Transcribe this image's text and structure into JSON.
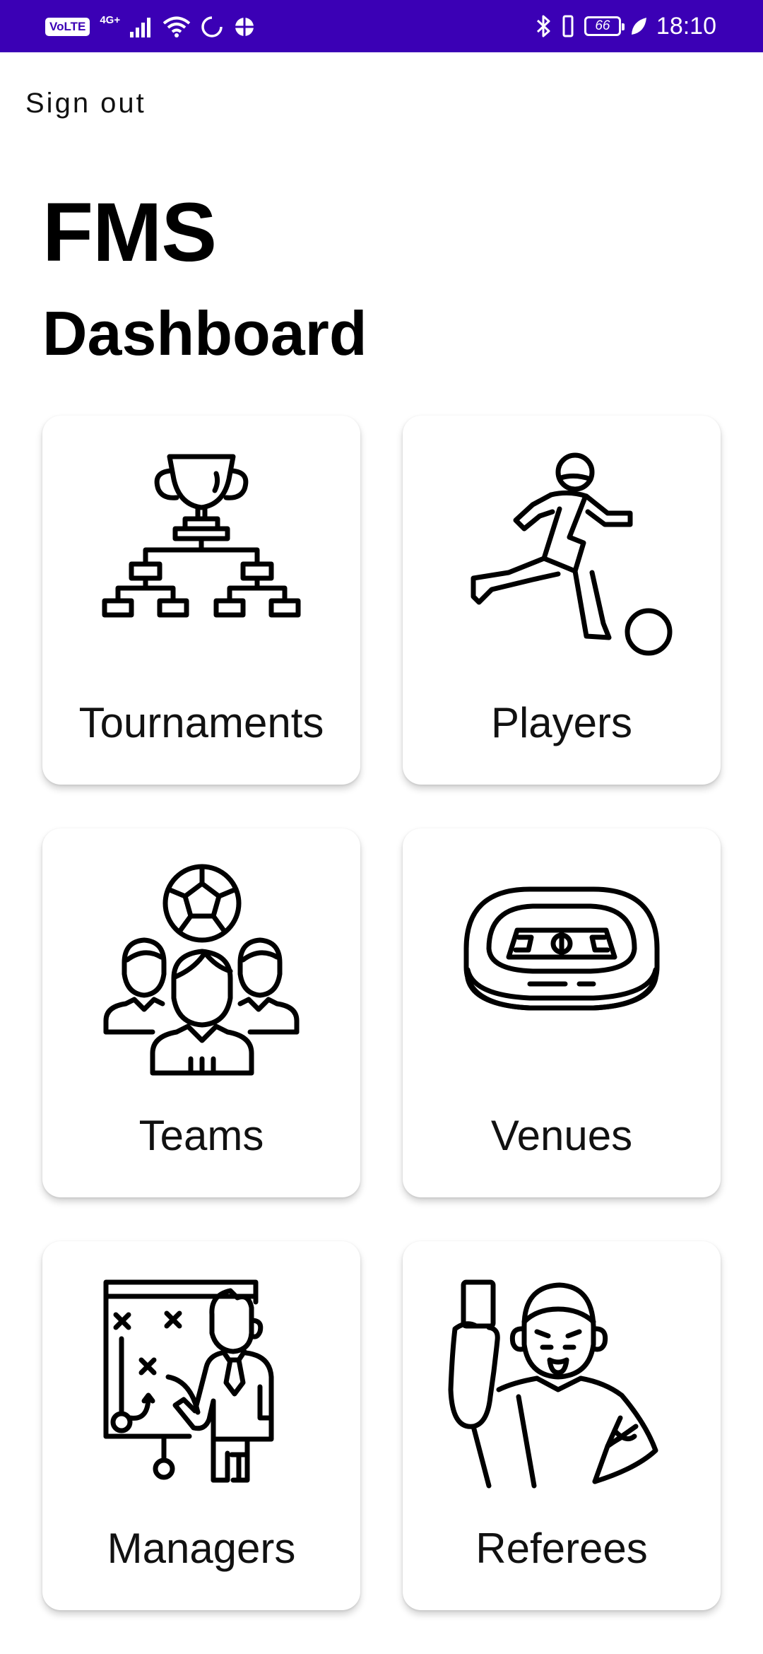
{
  "status_bar": {
    "volte": "VoLTE",
    "network": "4G+",
    "battery": "66",
    "time": "18:10",
    "icons": [
      "signal-icon",
      "wifi-icon",
      "sync-icon",
      "vpn-icon",
      "bluetooth-icon",
      "vibrate-icon",
      "battery-icon",
      "leaf-icon"
    ]
  },
  "header": {
    "sign_out_label": "Sign out",
    "app_title": "FMS",
    "page_title": "Dashboard"
  },
  "cards": [
    {
      "label": "Tournaments",
      "icon": "trophy-bracket-icon"
    },
    {
      "label": "Players",
      "icon": "football-player-icon"
    },
    {
      "label": "Teams",
      "icon": "team-icon"
    },
    {
      "label": "Venues",
      "icon": "stadium-icon"
    },
    {
      "label": "Managers",
      "icon": "tactics-board-icon"
    },
    {
      "label": "Referees",
      "icon": "referee-icon"
    }
  ],
  "colors": {
    "status_bar": "#3b00b5",
    "background": "#ffffff",
    "text": "#000000"
  }
}
